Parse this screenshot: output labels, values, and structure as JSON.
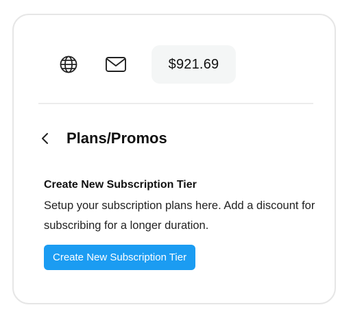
{
  "header": {
    "balance": "$921.69",
    "icons": [
      "globe-icon",
      "mail-icon"
    ]
  },
  "page": {
    "back_icon": "chevron-left-icon",
    "title": "Plans/Promos"
  },
  "subscription": {
    "heading": "Create New Subscription Tier",
    "description": "Setup your subscription plans here. Add a discount for subscribing for a longer duration.",
    "button_label": "Create New Subscription Tier",
    "button_color": "#1b9cf2"
  }
}
